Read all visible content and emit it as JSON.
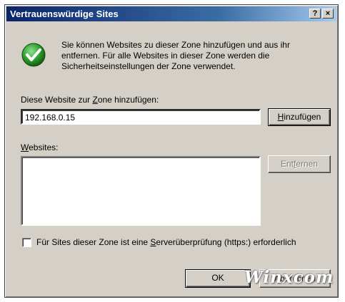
{
  "window": {
    "title": "Vertrauenswürdige Sites",
    "help_button": "?",
    "close_button": "×"
  },
  "info": {
    "icon": "green-check-icon",
    "text": "Sie können Websites zu dieser Zone hinzufügen und aus ihr entfernen. Für alle Websites in dieser Zone werden die Sicherheitseinstellungen der Zone verwendet."
  },
  "add_site": {
    "label_pre": "Diese Website zur ",
    "label_accel": "Z",
    "label_post": "one hinzufügen:",
    "value": "192.168.0.15",
    "add_button_accel": "H",
    "add_button_rest": "inzufügen"
  },
  "websites": {
    "label_accel": "W",
    "label_rest": "ebsites:",
    "items": [],
    "remove_button_pre": "Ent",
    "remove_button_accel": "f",
    "remove_button_post": "ernen"
  },
  "server_check": {
    "checked": false,
    "label_pre": "Für Sites dieser Zone ist eine ",
    "label_accel": "S",
    "label_post": "erverüberprüfung (https:) erforderlich"
  },
  "footer": {
    "ok_label": "OK",
    "cancel_label": "Abbrechen"
  },
  "watermark": "Winxcom",
  "colors": {
    "dialog_bg": "#d4d0c8",
    "title_start": "#0a246a",
    "title_end": "#a6caf0",
    "check_green": "#2e9e2e"
  }
}
